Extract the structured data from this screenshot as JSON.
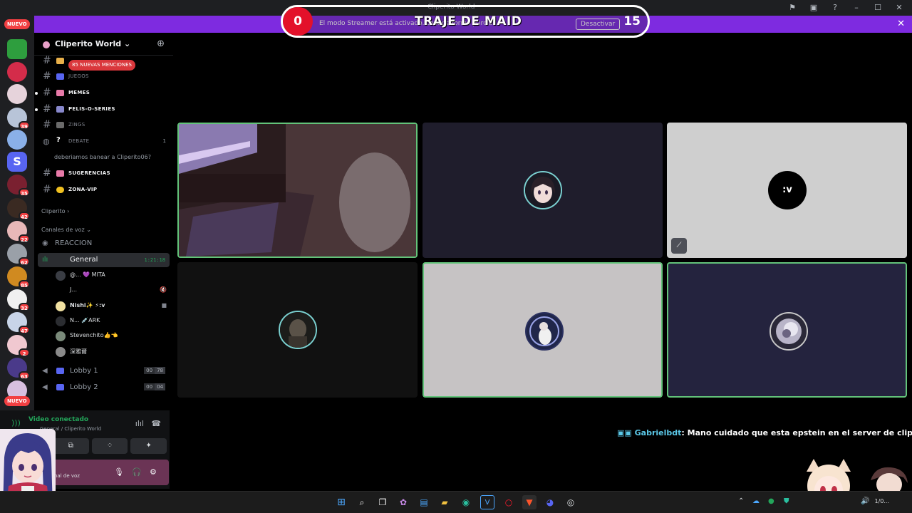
{
  "window": {
    "title": "Cliperito World"
  },
  "overlay": {
    "left_count": "0",
    "title": "TRAJE DE MAID",
    "right_count": "15"
  },
  "banner": {
    "message": "El modo Streamer está activado. Lo... de forma parcial.",
    "deactivate_label": "Desactivar"
  },
  "rail": {
    "nuevo_top": "NUEVO",
    "nuevo_bottom": "NUEVO",
    "badges": [
      "39",
      "35",
      "42",
      "22",
      "62",
      "85",
      "32",
      "47",
      "2",
      "63"
    ]
  },
  "server": {
    "name": "Cliperito World ⌄"
  },
  "mentions_pill": "85 NUEVAS MENCIONES",
  "channels": [
    {
      "name": "JUEGOS",
      "style": "dim"
    },
    {
      "name": "MEMES",
      "style": "bold"
    },
    {
      "name": "PELIS-O-SERIES",
      "style": "bold"
    },
    {
      "name": "ZINGS",
      "style": "dim"
    },
    {
      "name": "DEBATE",
      "style": "dim",
      "count": "1"
    },
    {
      "name": "SUGERENCIAS",
      "style": "bold"
    },
    {
      "name": "ZONA-VIP",
      "style": "bold"
    }
  ],
  "thread": "deberiamos banear a Cliperito06?",
  "categories": {
    "cliperito": "Cliperito ›",
    "voice": "Canales de voz ⌄"
  },
  "voice": {
    "reaccion": "REACCION",
    "general": "General",
    "general_time": "1:21:18",
    "lobby1": "Lobby 1",
    "lobby1_count": [
      "00",
      "78"
    ],
    "lobby2": "Lobby 2",
    "lobby2_count": [
      "00",
      "04"
    ]
  },
  "members": [
    {
      "name": "@... 💜 MITA"
    },
    {
      "name": "J..."
    },
    {
      "name": "Nishi✨ ⚡:v"
    },
    {
      "name": "N... 💉ARK"
    },
    {
      "name": "Stevenchito👍👈"
    },
    {
      "name": "深雅爾"
    }
  ],
  "panel": {
    "connected": "Video conectado",
    "subtitle": "General / Cliperito World",
    "channel_label": "nal de voz"
  },
  "tiles": [
    {
      "label": "camera-feed",
      "speaking": true
    },
    {
      "label": "anime-avatar",
      "speaking": false
    },
    {
      "label": ":v",
      "speaking": false
    },
    {
      "label": "dark-avatar",
      "speaking": false
    },
    {
      "label": "circle-avatar",
      "speaking": true
    },
    {
      "label": "glow-avatar",
      "speaking": true
    }
  ],
  "chat": {
    "user": "Gabrielbdt",
    "message": ": Mano cuidado que esta epstein en el server de cliperito"
  },
  "taskbar": {
    "clock": "1/0..."
  },
  "colors": {
    "accent": "#7e2be0",
    "speaking": "#63c37a",
    "alert": "#f23f42",
    "online": "#23a55a"
  }
}
